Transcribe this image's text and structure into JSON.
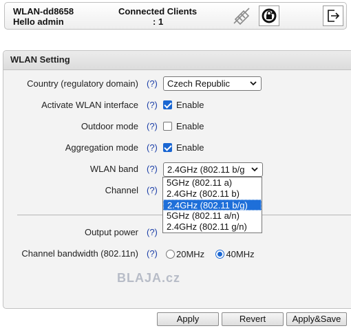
{
  "header": {
    "device_name": "WLAN-dd8658",
    "greeting": "Hello admin",
    "clients_label": "Connected Clients",
    "clients_count": ": 1"
  },
  "panel": {
    "title": "WLAN Setting",
    "help_text": "(?)",
    "country": {
      "label": "Country (regulatory domain)",
      "value": "Czech Republic"
    },
    "activate_wlan": {
      "label": "Activate WLAN interface",
      "checked": true,
      "text": "Enable"
    },
    "outdoor_mode": {
      "label": "Outdoor mode",
      "checked": false,
      "text": "Enable"
    },
    "aggregation_mode": {
      "label": "Aggregation mode",
      "checked": true,
      "text": "Enable"
    },
    "wlan_band": {
      "label": "WLAN band",
      "value": "2.4GHz (802.11 b/g",
      "options": [
        "5GHz (802.11 a)",
        "2.4GHz (802.11 b)",
        "2.4GHz (802.11 b/g)",
        "5GHz (802.11 a/n)",
        "2.4GHz (802.11 g/n)"
      ],
      "selected_option": "2.4GHz (802.11 b/g)"
    },
    "channel": {
      "label": "Channel"
    },
    "output_power": {
      "label": "Output power"
    },
    "channel_bandwidth": {
      "label": "Channel bandwidth (802.11n)",
      "option_20": "20MHz",
      "option_40": "40MHz",
      "selected": "40MHz"
    },
    "watermark": "BLAJA.cz"
  },
  "buttons": {
    "apply": "Apply",
    "revert": "Revert",
    "apply_save": "Apply&Save"
  },
  "icons": [
    "wireless-off-icon",
    "lock-refresh-icon",
    "logout-icon"
  ],
  "colors": {
    "accent": "#1a66d2",
    "help_link": "#1c3fa8",
    "selection": "#1e6fd9"
  }
}
